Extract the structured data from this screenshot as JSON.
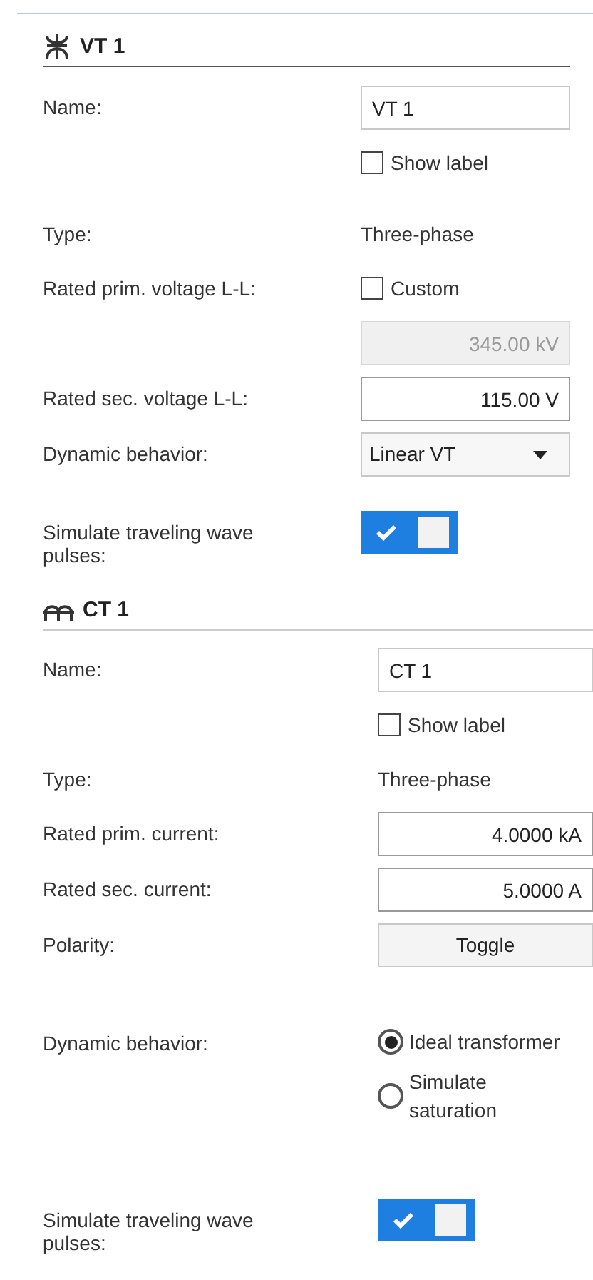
{
  "sections": [
    {
      "title": "VT 1",
      "rows": [
        {
          "kind": "text",
          "label": "Name:",
          "value": "VT 1"
        },
        {
          "kind": "checkbox",
          "text": "Show label",
          "checked": false
        },
        {
          "kind": "static",
          "label": "Type:",
          "value": "Three-phase"
        },
        {
          "kind": "checkbox",
          "label": "Rated prim. voltage L-L:",
          "text": "Custom",
          "checked": false
        },
        {
          "kind": "number",
          "value": "345.00 kV",
          "disabled": true
        },
        {
          "kind": "number",
          "label": "Rated sec. voltage L-L:",
          "value": "115.00 V",
          "disabled": false
        },
        {
          "kind": "select",
          "label": "Dynamic behavior:",
          "value": "Linear VT"
        },
        {
          "kind": "toggle",
          "label": "Simulate traveling wave pulses:",
          "on": true
        }
      ]
    },
    {
      "title": "CT 1",
      "rows": [
        {
          "kind": "text",
          "label": "Name:",
          "value": "CT 1"
        },
        {
          "kind": "checkbox",
          "text": "Show label",
          "checked": false
        },
        {
          "kind": "static",
          "label": "Type:",
          "value": "Three-phase"
        },
        {
          "kind": "number",
          "label": "Rated prim. current:",
          "value": "4.0000 kA",
          "disabled": false
        },
        {
          "kind": "number",
          "label": "Rated sec. current:",
          "value": "5.0000 A",
          "disabled": false
        },
        {
          "kind": "button",
          "label": "Polarity:",
          "value": "Toggle"
        },
        {
          "kind": "radio",
          "label": "Dynamic behavior:",
          "options": [
            {
              "text": "Ideal transformer",
              "selected": true
            },
            {
              "text": "Simulate saturation",
              "selected": false
            }
          ]
        },
        {
          "kind": "toggle",
          "label": "Simulate traveling wave pulses:",
          "on": true
        }
      ]
    }
  ]
}
